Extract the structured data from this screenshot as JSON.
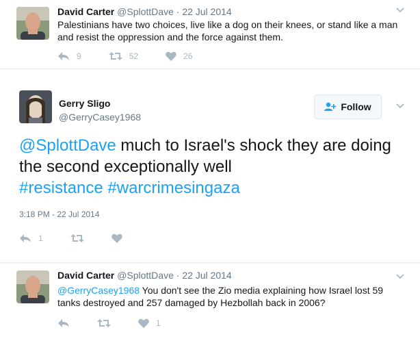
{
  "tweet1": {
    "name": "David Carter",
    "handle": "@SplottDave",
    "sep": "·",
    "time": "22 Jul 2014",
    "text": "Palestinians have two choices, live like a dog on their knees, or stand like a man and resist the oppression and the force against them.",
    "replies": "9",
    "retweets": "52",
    "likes": "26"
  },
  "tweet2": {
    "name": "Gerry Sligo",
    "handle": "@GerryCasey1968",
    "follow_label": "Follow",
    "mention": "@SplottDave",
    "text_part1": " much to Israel's shock they are doing the second exceptionally well ",
    "hashtag1": "#resistance",
    "hashtag2": "#warcrimesingaza",
    "datetime": "3:18 PM - 22 Jul 2014",
    "replies": "1"
  },
  "tweet3": {
    "name": "David Carter",
    "handle": "@SplottDave",
    "sep": "·",
    "time": "22 Jul 2014",
    "mention": "@GerryCasey1968",
    "text": " You don't see the Zio media explaining how Israel lost 59 tanks destroyed and 257 damaged by Hezbollah back in 2006?",
    "likes": "1"
  },
  "colors": {
    "link": "#1da1f2",
    "muted": "#657786",
    "icon": "#aab8c2"
  },
  "icons": [
    "reply-icon",
    "retweet-icon",
    "like-icon",
    "chevron-down-icon",
    "follow-person-icon"
  ]
}
